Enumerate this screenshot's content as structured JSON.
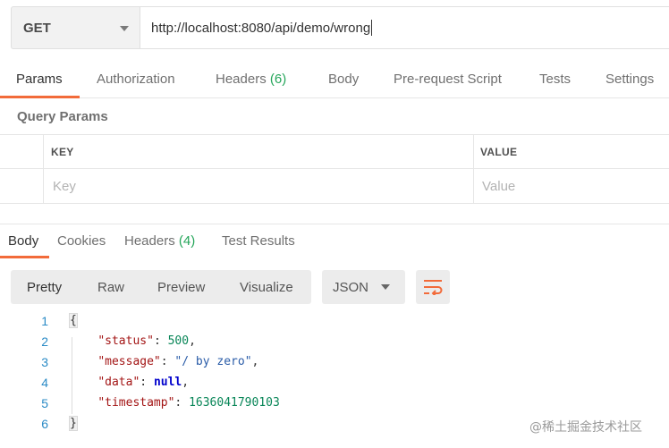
{
  "request": {
    "method": "GET",
    "url": "http://localhost:8080/api/demo/wrong"
  },
  "request_tabs": {
    "params": "Params",
    "authorization": "Authorization",
    "headers": "Headers",
    "headers_count": "(6)",
    "body": "Body",
    "prerequest": "Pre-request Script",
    "tests": "Tests",
    "settings": "Settings"
  },
  "query_params": {
    "title": "Query Params",
    "columns": [
      "KEY",
      "VALUE"
    ],
    "key_placeholder": "Key",
    "value_placeholder": "Value"
  },
  "response_tabs": {
    "body": "Body",
    "cookies": "Cookies",
    "headers": "Headers",
    "headers_count": "(4)",
    "test_results": "Test Results"
  },
  "view": {
    "pretty": "Pretty",
    "raw": "Raw",
    "preview": "Preview",
    "visualize": "Visualize",
    "format": "JSON",
    "wrap_icon": "wrap-lines-icon"
  },
  "code": {
    "line_numbers": [
      "1",
      "2",
      "3",
      "4",
      "5",
      "6"
    ],
    "open_brace": "{",
    "close_brace": "}",
    "status_key": "\"status\"",
    "status_value": "500",
    "message_key": "\"message\"",
    "message_value": "\"/ by zero\"",
    "data_key": "\"data\"",
    "data_value": "null",
    "timestamp_key": "\"timestamp\"",
    "timestamp_value": "1636041790103"
  },
  "watermark": "@稀土掘金技术社区",
  "colors": {
    "accent": "#f26b3a",
    "count_green": "#26a65b",
    "line_number_blue": "#2b8bc6"
  }
}
